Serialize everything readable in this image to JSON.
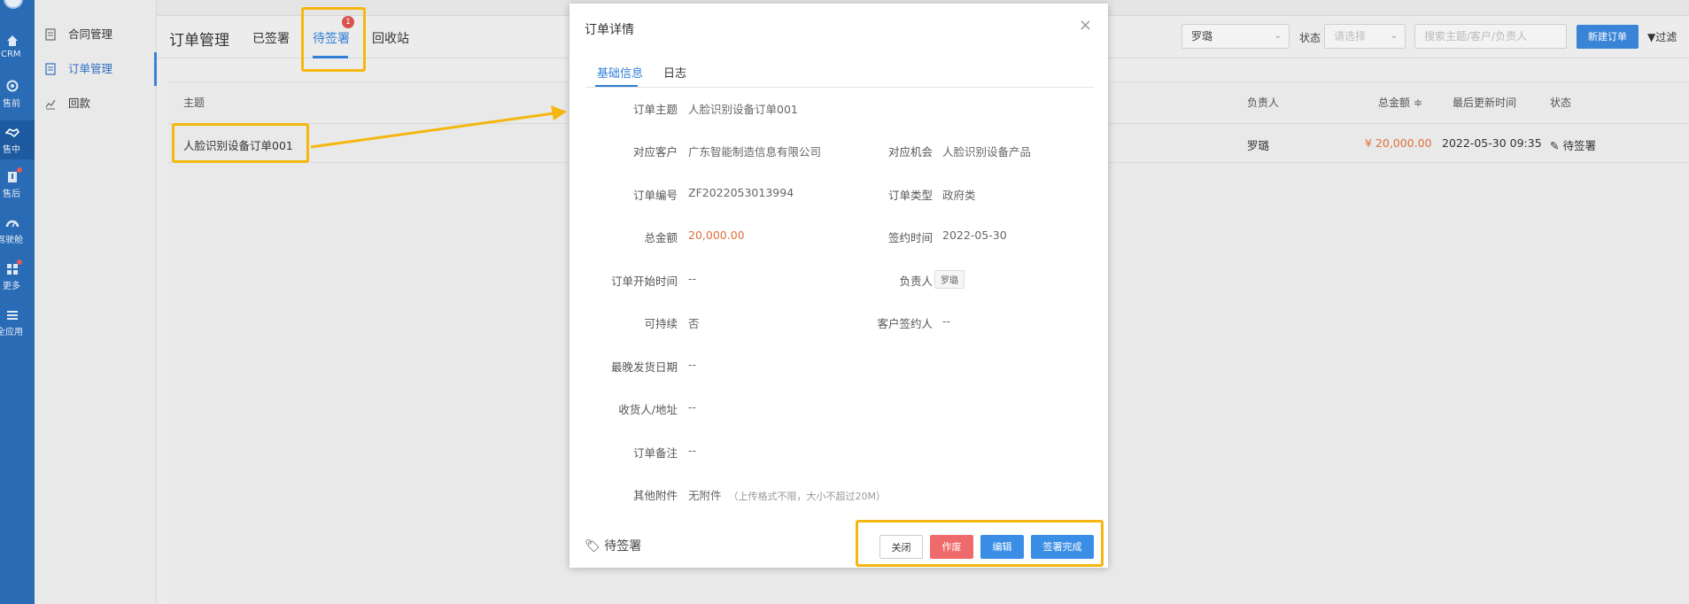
{
  "rail": {
    "items": [
      {
        "label": "CRM",
        "icon": "home-icon"
      },
      {
        "label": "售前",
        "icon": "pin-icon"
      },
      {
        "label": "售中",
        "icon": "handshake-icon"
      },
      {
        "label": "售后",
        "icon": "badge-icon"
      },
      {
        "label": "驾驶舱",
        "icon": "dashboard-icon"
      },
      {
        "label": "更多",
        "icon": "grid-icon"
      },
      {
        "label": "全应用",
        "icon": "menu-icon"
      }
    ]
  },
  "nav": {
    "items": [
      {
        "label": "合同管理"
      },
      {
        "label": "订单管理"
      },
      {
        "label": "回款"
      }
    ]
  },
  "toolbar": {
    "title": "订单管理",
    "tabs": [
      "已签署",
      "待签署",
      "回收站"
    ],
    "badge": "1",
    "owner_select": "罗璐",
    "status_label": "状态",
    "status_placeholder": "请选择",
    "search_placeholder": "搜索主题/客户/负责人",
    "new_button": "新建订单",
    "filter": "▼过滤"
  },
  "table": {
    "headers": {
      "subject": "主题",
      "owner": "负责人",
      "amount": "总金额 ≑",
      "updated": "最后更新时间",
      "status": "状态"
    },
    "row": {
      "subject": "人脸识别设备订单001",
      "owner": "罗璐",
      "amount": "¥ 20,000.00",
      "updated": "2022-05-30 09:35",
      "status": "✎ 待签署"
    }
  },
  "modal": {
    "title": "订单详情",
    "close": "×",
    "tabs": [
      "基础信息",
      "日志"
    ],
    "fields": {
      "subject_label": "订单主题",
      "subject": "人脸识别设备订单001",
      "customer_label": "对应客户",
      "customer": "广东智能制造信息有限公司",
      "opportunity_label": "对应机会",
      "opportunity": "人脸识别设备产品",
      "order_no_label": "订单编号",
      "order_no": "ZF2022053013994",
      "order_type_label": "订单类型",
      "order_type": "政府类",
      "amount_label": "总金额",
      "amount": "20,000.00",
      "sign_date_label": "签约时间",
      "sign_date": "2022-05-30",
      "start_label": "订单开始时间",
      "start": "--",
      "owner_label": "负责人",
      "owner": "罗璐",
      "renew_label": "可持续",
      "renew": "否",
      "signer_label": "客户签约人",
      "signer": "--",
      "ship_label": "最晚发货日期",
      "ship": "--",
      "receiver_label": "收货人/地址",
      "receiver": "--",
      "remark_label": "订单备注",
      "remark": "--",
      "attach_label": "其他附件",
      "attach": "无附件",
      "attach_note": "（上传格式不限，大小不超过20M）"
    },
    "status": "待签署",
    "buttons": {
      "close": "关闭",
      "void": "作废",
      "edit": "编辑",
      "done": "签署完成"
    }
  },
  "colors": {
    "accent": "#2f7fd6",
    "highlight": "#f5b70f",
    "danger": "#ef6b6b",
    "money": "#e0703a",
    "rail": "#2a6bb5"
  }
}
